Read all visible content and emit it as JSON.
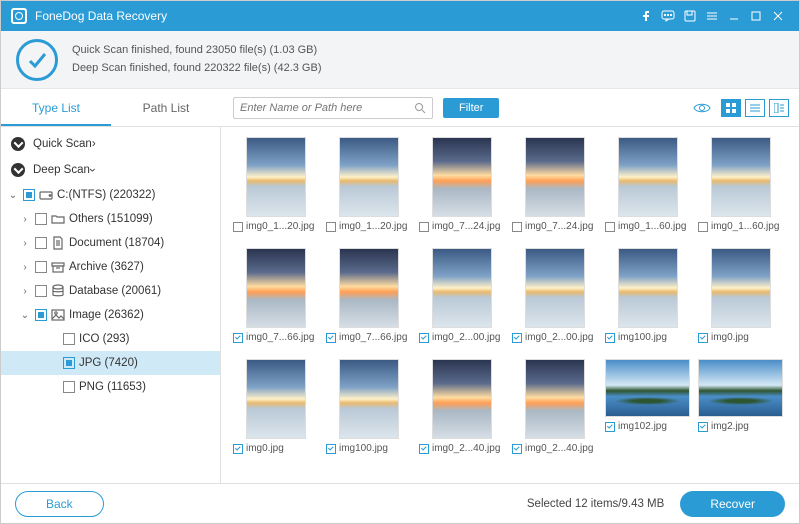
{
  "app": {
    "title": "FoneDog Data Recovery"
  },
  "status": {
    "line1": "Quick Scan finished, found 23050 file(s) (1.03 GB)",
    "line2": "Deep Scan finished, found 220322 file(s) (42.3 GB)"
  },
  "tabs": {
    "type_list": "Type List",
    "path_list": "Path List"
  },
  "search": {
    "placeholder": "Enter Name or Path here"
  },
  "toolbar": {
    "filter": "Filter"
  },
  "tree": {
    "quick_scan": "Quick Scan",
    "deep_scan": "Deep Scan",
    "drive": "C:(NTFS) (220322)",
    "others": "Others (151099)",
    "document": "Document (18704)",
    "archive": "Archive (3627)",
    "database": "Database (20061)",
    "image": "Image (26362)",
    "ico": "ICO (293)",
    "jpg": "JPG (7420)",
    "png": "PNG (11653)"
  },
  "grid": [
    {
      "name": "img0_1...20.jpg",
      "checked": false,
      "variant": "day"
    },
    {
      "name": "img0_1...20.jpg",
      "checked": false,
      "variant": "day"
    },
    {
      "name": "img0_7...24.jpg",
      "checked": false,
      "variant": "sunset"
    },
    {
      "name": "img0_7...24.jpg",
      "checked": false,
      "variant": "sunset"
    },
    {
      "name": "img0_1...60.jpg",
      "checked": false,
      "variant": "day"
    },
    {
      "name": "img0_1...60.jpg",
      "checked": false,
      "variant": "day"
    },
    {
      "name": "img0_7...66.jpg",
      "checked": true,
      "variant": "sunset"
    },
    {
      "name": "img0_7...66.jpg",
      "checked": true,
      "variant": "sunset"
    },
    {
      "name": "img0_2...00.jpg",
      "checked": true,
      "variant": "day"
    },
    {
      "name": "img0_2...00.jpg",
      "checked": true,
      "variant": "day"
    },
    {
      "name": "img100.jpg",
      "checked": true,
      "variant": "day"
    },
    {
      "name": "img0.jpg",
      "checked": true,
      "variant": "day"
    },
    {
      "name": "img0.jpg",
      "checked": true,
      "variant": "day"
    },
    {
      "name": "img100.jpg",
      "checked": true,
      "variant": "day"
    },
    {
      "name": "img0_2...40.jpg",
      "checked": true,
      "variant": "sunset"
    },
    {
      "name": "img0_2...40.jpg",
      "checked": true,
      "variant": "sunset"
    },
    {
      "name": "img102.jpg",
      "checked": true,
      "variant": "island"
    },
    {
      "name": "img2.jpg",
      "checked": true,
      "variant": "island"
    }
  ],
  "footer": {
    "back": "Back",
    "selected": "Selected 12 items/9.43 MB",
    "recover": "Recover"
  }
}
